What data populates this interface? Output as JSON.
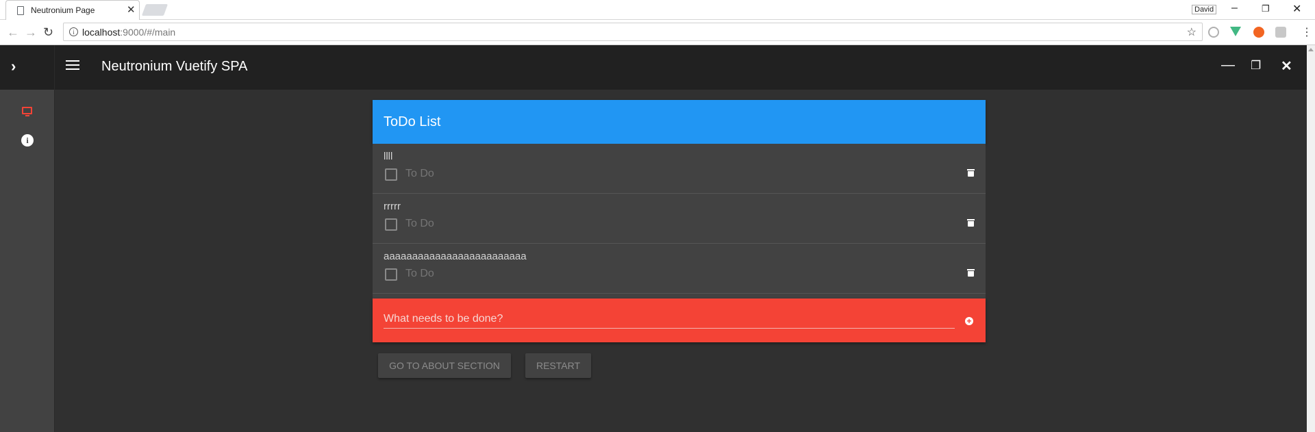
{
  "browser": {
    "tab_title": "Neutronium Page",
    "profile_name": "David",
    "url_host": "localhost",
    "url_rest": ":9000/#/main"
  },
  "app": {
    "title": "Neutronium Vuetify SPA",
    "accent_colors": {
      "header": "#2196f3",
      "new_todo": "#f44336",
      "toolbar": "#212121"
    }
  },
  "todo_card": {
    "title": "ToDo List",
    "items": [
      {
        "description": "llll",
        "label": "To Do",
        "done": false
      },
      {
        "description": "rrrrr",
        "label": "To Do",
        "done": false
      },
      {
        "description": "aaaaaaaaaaaaaaaaaaaaaaaaa",
        "label": "To Do",
        "done": false
      }
    ],
    "new_todo_placeholder": "What needs to be done?"
  },
  "buttons": {
    "about": "Go to about section",
    "restart": "Restart"
  }
}
